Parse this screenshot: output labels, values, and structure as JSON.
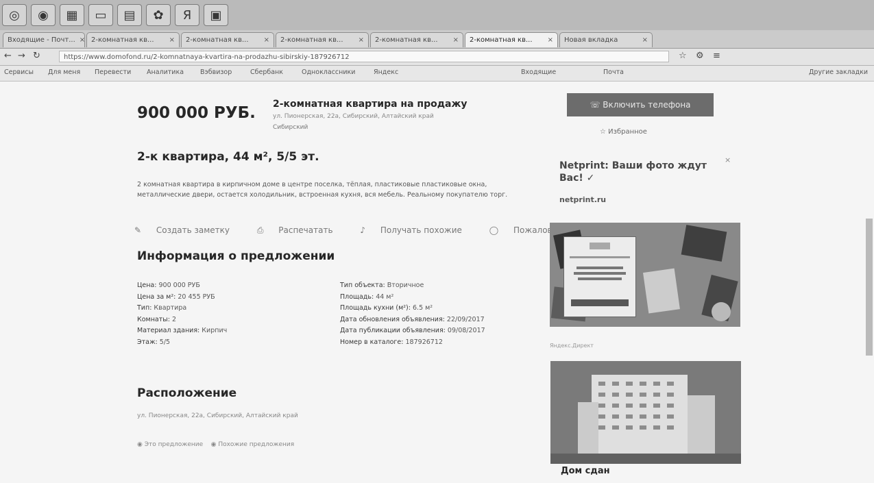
{
  "tabs": [
    {
      "label": "Входящие - Почт...",
      "active": false
    },
    {
      "label": "2-комнатная кв...",
      "active": false
    },
    {
      "label": "2-комнатная кв...",
      "active": false
    },
    {
      "label": "2-комнатная кв...",
      "active": false
    },
    {
      "label": "2-комнатная кв...",
      "active": false
    },
    {
      "label": "2-комнатная кв...",
      "active": true
    },
    {
      "label": "Новая вкладка",
      "active": false
    }
  ],
  "address": {
    "url": "https://www.domofond.ru/2-komnatnaya-kvartira-na-prodazhu-sibirskiy-187926712"
  },
  "bookmarks": [
    "Сервисы",
    "Для меня",
    "Перевести",
    "Аналитика",
    "Вэбвизор",
    "Сбербанк",
    "Одноклассники",
    "Яндекс",
    "Входящие",
    "Почта",
    "Другие закладки"
  ],
  "listing": {
    "price": "900 000 РУБ.",
    "headline": "2-комнатная квартира на продажу",
    "address": "ул. Пионерская, 22а, Сибирский, Алтайский край",
    "district": "Сибирский",
    "title": "2-к квартира, 44 м², 5/5 эт.",
    "description": "2 комнатная квартира в кирпичном доме в центре поселка, тёплая, пластиковые пластиковые окна, металлические двери, остается холодильник, встроенная кухня, вся мебель. Реальному покупателю торг.",
    "actions": [
      "Создать заметку",
      "Распечатать",
      "Получать похожие",
      "Пожаловаться"
    ]
  },
  "offer": {
    "heading": "Информация о предложении",
    "left": [
      {
        "k": "Цена:",
        "v": "900 000 РУБ"
      },
      {
        "k": "Цена за м²:",
        "v": "20 455 РУБ"
      },
      {
        "k": "Тип:",
        "v": "Квартира"
      },
      {
        "k": "Комнаты:",
        "v": "2"
      },
      {
        "k": "Материал здания:",
        "v": "Кирпич"
      },
      {
        "k": "Этаж:",
        "v": "5/5"
      }
    ],
    "right": [
      {
        "k": "Тип объекта:",
        "v": "Вторичное"
      },
      {
        "k": "Площадь:",
        "v": "44 м²"
      },
      {
        "k": "Площадь кухни (м²):",
        "v": "6.5 м²"
      },
      {
        "k": "Дата обновления объявления:",
        "v": "22/09/2017"
      },
      {
        "k": "Дата публикации объявления:",
        "v": "09/08/2017"
      },
      {
        "k": "Номер в каталоге:",
        "v": "187926712"
      }
    ]
  },
  "location": {
    "heading": "Расположение",
    "address": "ул. Пионерская, 22а, Сибирский, Алтайский край",
    "options": [
      "Это предложение",
      "Похожие предложения"
    ]
  },
  "sidebar": {
    "call_label": "Включить телефона",
    "favorite": "Избранное",
    "ad_title": "Netprint: Ваши фото ждут Вас! ✓",
    "ad_site": "netprint.ru",
    "ad_caption": "Яндекс.Директ",
    "building_caption": "Дом сдан"
  }
}
